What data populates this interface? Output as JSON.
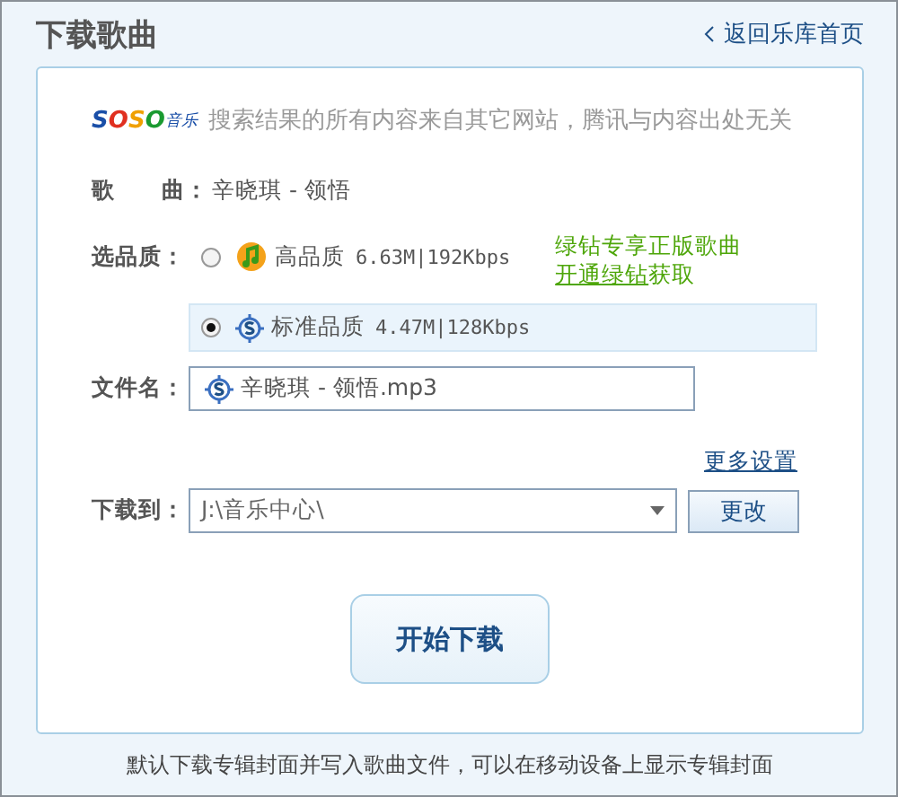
{
  "window": {
    "title": "下载歌曲",
    "back_link": "返回乐库首页"
  },
  "notice": {
    "logo": "SOSO",
    "logo_suffix": "音乐",
    "text": "搜索结果的所有内容来自其它网站，腾讯与内容出处无关"
  },
  "song": {
    "label": "歌　　曲：",
    "value": "辛晓琪 - 领悟"
  },
  "quality": {
    "label": "选品质：",
    "options": [
      {
        "kind": "premium",
        "name": "高品质",
        "info": "6.63M|192Kbps",
        "selected": false
      },
      {
        "kind": "standard",
        "name": "标准品质",
        "info": "4.47M|128Kbps",
        "selected": true
      }
    ],
    "promo": {
      "line": "绿钻专享正版歌曲",
      "link": "开通绿钻",
      "rest": "获取"
    }
  },
  "filename": {
    "label": "文件名：",
    "value": "辛晓琪 - 领悟.mp3"
  },
  "more_settings": "更多设置",
  "destination": {
    "label": "下载到：",
    "value": "J:\\音乐中心\\",
    "button": "更改"
  },
  "start_button": "开始下载",
  "footer": "默认下载专辑封面并写入歌曲文件，可以在移动设备上显示专辑封面"
}
